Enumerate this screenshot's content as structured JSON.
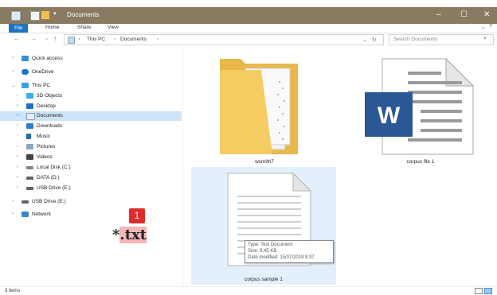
{
  "window": {
    "title": "Documents"
  },
  "ribbon": {
    "tabs": [
      "File",
      "Home",
      "Share",
      "View"
    ]
  },
  "address": {
    "path": [
      "This PC",
      "Documents"
    ]
  },
  "search": {
    "placeholder": "Search Documents"
  },
  "nav": {
    "items": [
      {
        "label": "Quick access",
        "icon": "star-icon"
      },
      {
        "label": "OneDrive",
        "icon": "cloud-icon"
      },
      {
        "label": "This PC",
        "icon": "computer-icon"
      },
      {
        "label": "3D Objects",
        "icon": "cube-icon"
      },
      {
        "label": "Desktop",
        "icon": "desktop-icon"
      },
      {
        "label": "Documents",
        "icon": "documents-icon"
      },
      {
        "label": "Downloads",
        "icon": "download-icon"
      },
      {
        "label": "Music",
        "icon": "music-icon"
      },
      {
        "label": "Pictures",
        "icon": "pictures-icon"
      },
      {
        "label": "Videos",
        "icon": "videos-icon"
      },
      {
        "label": "Local Disk (C:)",
        "icon": "drive-icon"
      },
      {
        "label": "DATA (D:)",
        "icon": "drive-icon"
      },
      {
        "label": "USB Drive (E:)",
        "icon": "usb-drive-icon"
      },
      {
        "label": "USB Drive (E:)",
        "icon": "usb-drive-icon"
      },
      {
        "label": "Network",
        "icon": "network-icon"
      }
    ]
  },
  "files": [
    {
      "name": "wsmith7",
      "icon": "folder-icon"
    },
    {
      "name": "corpus file 1",
      "icon": "word-document-icon"
    },
    {
      "name": "corpus sample 1",
      "icon": "text-document-icon"
    }
  ],
  "tooltip": {
    "type": "Type: Text Document",
    "size": "Size: 9,45 KB",
    "modified": "Date modified: 15/07/2019 9:37"
  },
  "annotation": {
    "badge": "1",
    "prefix": "*",
    "ext": ".txt"
  },
  "status": {
    "count": "3 items"
  },
  "colors": {
    "accent": "#1e73be",
    "titlebar": "#8a7a62",
    "selection": "#cce4f7",
    "badge": "#e02b2b"
  }
}
